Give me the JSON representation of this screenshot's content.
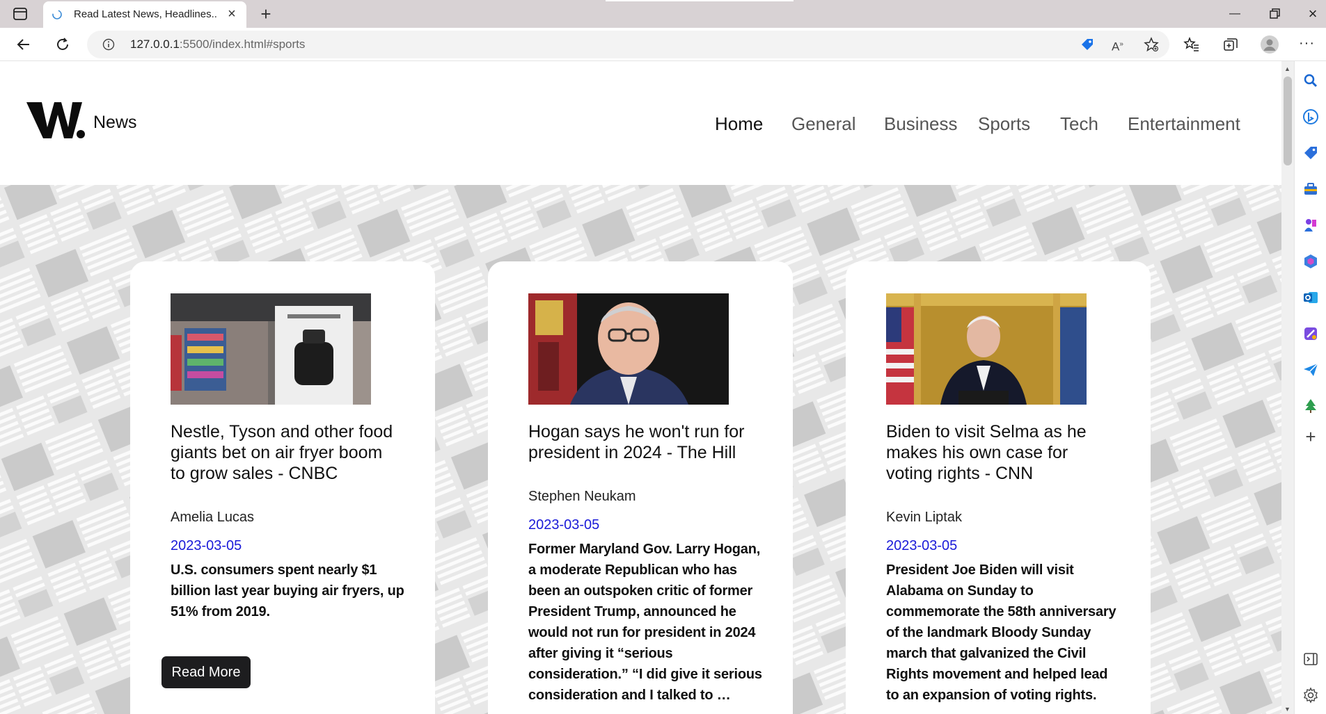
{
  "browser": {
    "tab_title": "Read Latest News, Headlines..",
    "url_host": "127.0.0.1",
    "url_rest": ":5500/index.html#sports"
  },
  "site": {
    "logo_letter": "W.",
    "logo_text": "News",
    "nav": [
      {
        "label": "Home",
        "active": true
      },
      {
        "label": "General",
        "active": false
      },
      {
        "label": "Business",
        "active": false
      },
      {
        "label": "Sports",
        "active": false
      },
      {
        "label": "Tech",
        "active": false
      },
      {
        "label": "Entertainment",
        "active": false
      }
    ]
  },
  "cards": [
    {
      "headline": "Nestle, Tyson and other food giants bet on air fryer boom to grow sales - CNBC",
      "author": "Amelia Lucas",
      "date": "2023-03-05",
      "description": "U.S. consumers spent nearly $1 billion last year buying air fryers, up 51% from 2019.",
      "button": "Read More"
    },
    {
      "headline": "Hogan says he won't run for president in 2024 - The Hill",
      "author": "Stephen Neukam",
      "date": "2023-03-05",
      "description": "Former Maryland Gov. Larry Hogan, a moderate Republican who has been an outspoken critic of former President Trump, announced he would not run for president in 2024 after giving it “serious consideration.” “I did give it serious consideration and I talked to …"
    },
    {
      "headline": "Biden to visit Selma as he makes his own case for voting rights - CNN",
      "author": "Kevin Liptak",
      "date": "2023-03-05",
      "description": "President Joe Biden will visit Alabama on Sunday to commemorate the 58th anniversary of the landmark Bloody Sunday march that galvanized the Civil Rights movement and helped lead to an expansion of voting rights."
    }
  ],
  "colors": {
    "date": "#1a1ad8",
    "button_bg": "#1d1d1f",
    "hero_bg": "#e6e6e6"
  }
}
